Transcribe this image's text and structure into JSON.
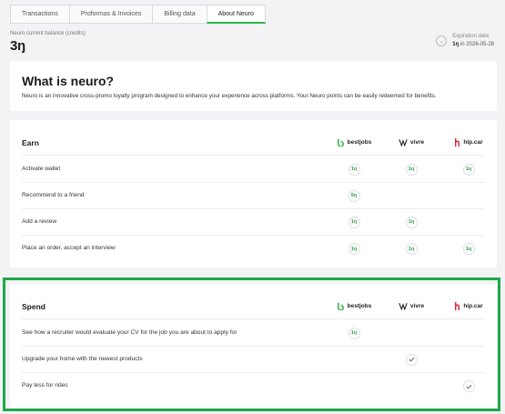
{
  "tabs": [
    "Transactions",
    "Proformas & Invoices",
    "Billing data",
    "About Neuro"
  ],
  "balance": {
    "label": "Neuro current balance (credits)",
    "value": "3ŋ"
  },
  "expiry": {
    "title": "Expiration date",
    "amount": "1ŋ",
    "date_text": "in 2026-05-28"
  },
  "what": {
    "title": "What is neuro?",
    "description": "Neuro is an innovative cross-promo loyalty program designed to enhance your experience across platforms. Your Neuro points can be easily redeemed for benefits."
  },
  "brands": [
    "bestjobs",
    "vivre",
    "hip.car"
  ],
  "earn": {
    "title": "Earn",
    "rows": [
      {
        "label": "Activate wallet",
        "values": [
          "1ŋ",
          "1ŋ",
          "1ŋ"
        ]
      },
      {
        "label": "Recommend to a friend",
        "values": [
          "5ŋ",
          "",
          ""
        ]
      },
      {
        "label": "Add a review",
        "values": [
          "1ŋ",
          "1ŋ",
          ""
        ]
      },
      {
        "label": "Place an order, accept an interview",
        "values": [
          "1ŋ",
          "1ŋ",
          "1ŋ"
        ]
      }
    ]
  },
  "spend": {
    "title": "Spend",
    "rows": [
      {
        "label": "See how a recruiter would evaluate your CV for the job you are about to apply for",
        "values": [
          "1ŋ",
          "",
          ""
        ]
      },
      {
        "label": "Upgrade your home with the newest products",
        "values": [
          "",
          "check",
          ""
        ]
      },
      {
        "label": "Pay less for rides",
        "values": [
          "",
          "",
          "check"
        ]
      }
    ]
  },
  "colors": {
    "accent": "#2bb34a",
    "highlight": "#1fa84a",
    "hipcar": "#d8263a",
    "bestjobs": "#37b54a"
  }
}
